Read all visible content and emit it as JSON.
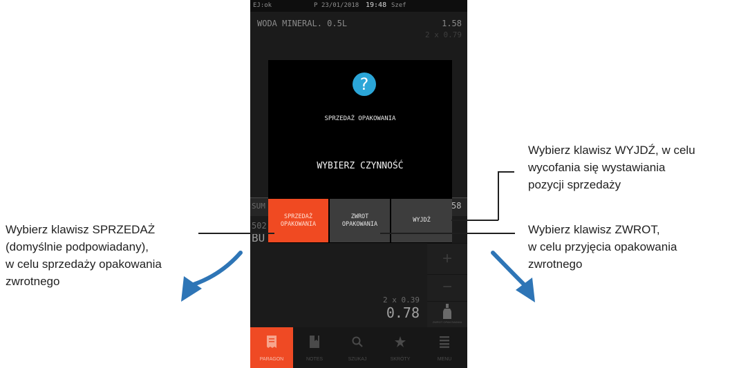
{
  "status_bar": {
    "left": "EJ:ok",
    "prefix": "P",
    "date": "23/01/2018",
    "time": "19:48",
    "user": "Szef"
  },
  "receipt": {
    "item_name": "WODA MINERAL. 0.5L",
    "item_total": "1.58",
    "item_qty": "2 x 0.79",
    "sum_label": "SUM",
    "sum_value": "58",
    "code_fragment": "502",
    "name_fragment": "BU",
    "current_qty": "2 x 0.39",
    "current_value": "0.78"
  },
  "side_buttons": {
    "plus": "+",
    "minus": "−",
    "bottle_caption": "ZWROT OPAKOWANIA"
  },
  "dialog": {
    "icon": "question-icon",
    "icon_glyph": "?",
    "title": "SPRZEDAŻ OPAKOWANIA",
    "prompt": "WYBIERZ CZYNNOŚĆ",
    "buttons": {
      "sale_line1": "SPRZEDAŻ",
      "sale_line2": "OPAKOWANIA",
      "return_line1": "ZWROT",
      "return_line2": "OPAKOWANIA",
      "exit": "WYJDŹ"
    }
  },
  "nav": {
    "items": [
      {
        "label": "PARAGON",
        "icon": "receipt-icon",
        "active": true
      },
      {
        "label": "NOTES",
        "icon": "notes-icon",
        "active": false
      },
      {
        "label": "SZUKAJ",
        "icon": "search-icon",
        "active": false
      },
      {
        "label": "SKRÓTY",
        "icon": "star-icon",
        "active": false
      },
      {
        "label": "MENU",
        "icon": "menu-icon",
        "active": false
      }
    ]
  },
  "annotations": {
    "left": [
      "Wybierz klawisz SPRZEDAŻ",
      "(domyślnie podpowiadany),",
      "w celu sprzedaży opakowania",
      "zwrotnego"
    ],
    "right_top": [
      "Wybierz klawisz WYJDŹ, w celu",
      "wycofania się  wystawiania",
      "pozycji sprzedaży"
    ],
    "right_bottom": [
      "Wybierz klawisz ZWROT,",
      "w celu przyjęcia opakowania",
      "zwrotnego"
    ]
  },
  "colors": {
    "accent": "#ef4a24",
    "info": "#2ba6d8",
    "arrow": "#2e75b6"
  }
}
